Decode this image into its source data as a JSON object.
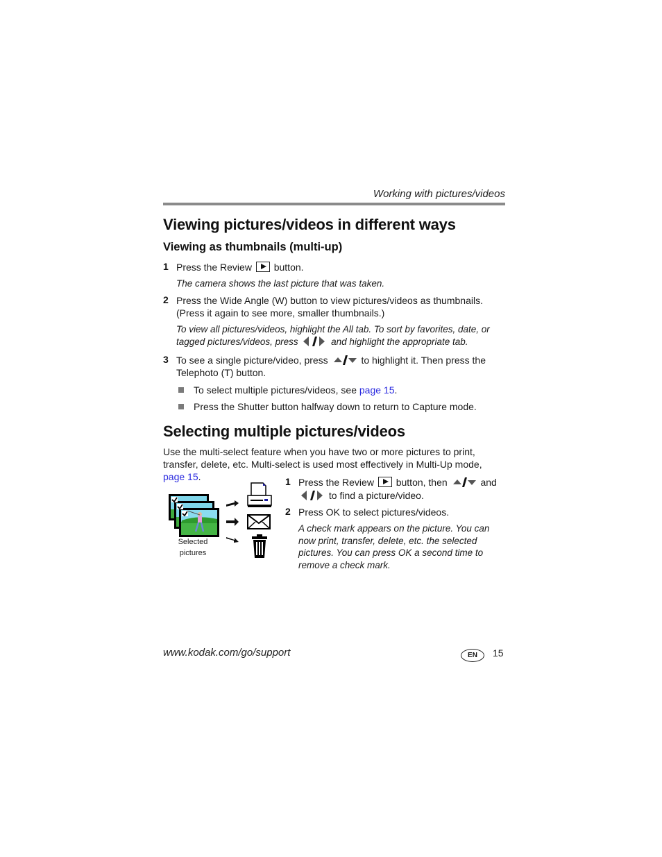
{
  "header": {
    "running_title": "Working with pictures/videos"
  },
  "section1": {
    "title": "Viewing pictures/videos in different ways",
    "subtitle": "Viewing as thumbnails (multi-up)",
    "steps": [
      {
        "num": "1",
        "text_before": "Press the Review",
        "text_after": "button.",
        "note": "The camera shows the last picture that was taken."
      },
      {
        "num": "2",
        "text": "Press the Wide Angle (W) button to view pictures/videos as thumbnails. (Press it again to see more, smaller thumbnails.)",
        "note_before": "To view all pictures/videos, highlight the All tab. To sort by favorites, date, or tagged pictures/videos, press",
        "note_after": "and highlight the appropriate tab."
      },
      {
        "num": "3",
        "text_before": "To see a single picture/video, press",
        "text_after": "to highlight it. Then press the Telephoto (T) button."
      }
    ],
    "bullets": [
      {
        "text_before": "To select multiple pictures/videos, see ",
        "link": "page 15",
        "text_after": "."
      },
      {
        "text": "Press the Shutter button halfway down to return to Capture mode."
      }
    ]
  },
  "section2": {
    "title": "Selecting multiple pictures/videos",
    "intro_before": "Use the multi-select feature when you have two or more pictures to print, transfer, delete, etc. Multi-select is used most effectively in Multi-Up mode, ",
    "intro_link": "page 15",
    "intro_after": ".",
    "figure_caption": "Selected pictures",
    "figure_icons": [
      "printer-icon",
      "envelope-icon",
      "trash-icon"
    ],
    "steps": [
      {
        "num": "1",
        "text_before": "Press the Review",
        "text_mid": "button, then",
        "text_and": "and",
        "text_after": "to find a picture/video."
      },
      {
        "num": "2",
        "text": "Press OK to select pictures/videos.",
        "note": "A check mark appears on the picture. You can now print, transfer, delete, etc. the selected pictures. You can press OK a second time to remove a check mark."
      }
    ]
  },
  "footer": {
    "url": "www.kodak.com/go/support",
    "language_badge": "EN",
    "page_number": "15"
  },
  "colors": {
    "link": "#2a2adf",
    "rule": "#8a8a8a",
    "bullet": "#7a7a7a"
  }
}
